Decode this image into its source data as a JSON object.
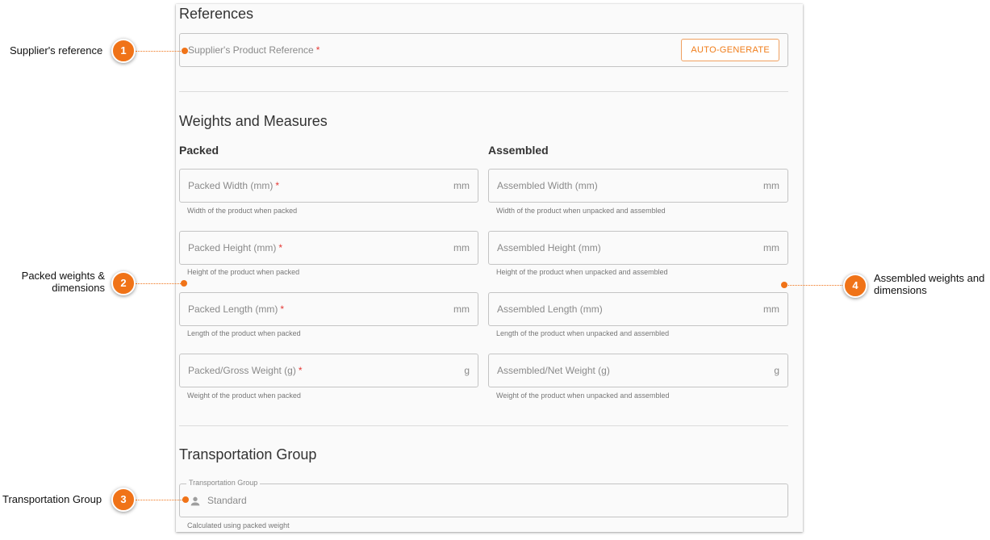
{
  "references": {
    "title": "References",
    "supplier_ref_placeholder": "Supplier's Product Reference",
    "required_mark": "*",
    "autogen_label": "AUTO-GENERATE"
  },
  "weights": {
    "title": "Weights and Measures",
    "packed": {
      "title": "Packed",
      "fields": [
        {
          "label": "Packed Width (mm)",
          "required": "*",
          "unit": "mm",
          "helper": "Width of the product when packed"
        },
        {
          "label": "Packed Height (mm)",
          "required": "*",
          "unit": "mm",
          "helper": "Height of the product when packed"
        },
        {
          "label": "Packed Length (mm)",
          "required": "*",
          "unit": "mm",
          "helper": "Length of the product when packed"
        },
        {
          "label": "Packed/Gross Weight (g)",
          "required": "*",
          "unit": "g",
          "helper": "Weight of the product when packed"
        }
      ]
    },
    "assembled": {
      "title": "Assembled",
      "fields": [
        {
          "label": "Assembled Width (mm)",
          "unit": "mm",
          "helper": "Width of the product when unpacked and assembled"
        },
        {
          "label": "Assembled Height (mm)",
          "unit": "mm",
          "helper": "Height of the product when unpacked and assembled"
        },
        {
          "label": "Assembled Length (mm)",
          "unit": "mm",
          "helper": "Length of the product when unpacked and assembled"
        },
        {
          "label": "Assembled/Net Weight (g)",
          "unit": "g",
          "helper": "Weight of the product when unpacked and assembled"
        }
      ]
    }
  },
  "transport": {
    "title": "Transportation Group",
    "field_legend": "Transportation Group",
    "value": "Standard",
    "helper": "Calculated using packed weight",
    "icon": "person-icon"
  },
  "callouts": [
    {
      "number": "1",
      "label": "Supplier's reference"
    },
    {
      "number": "2",
      "label_line1": "Packed weights &",
      "label_line2": "dimensions"
    },
    {
      "number": "3",
      "label": "Transportation Group"
    },
    {
      "number": "4",
      "label_line1": "Assembled weights and",
      "label_line2": "dimensions"
    }
  ],
  "colors": {
    "accent": "#f07318",
    "required": "#e53935",
    "border": "#c4c4c4"
  }
}
